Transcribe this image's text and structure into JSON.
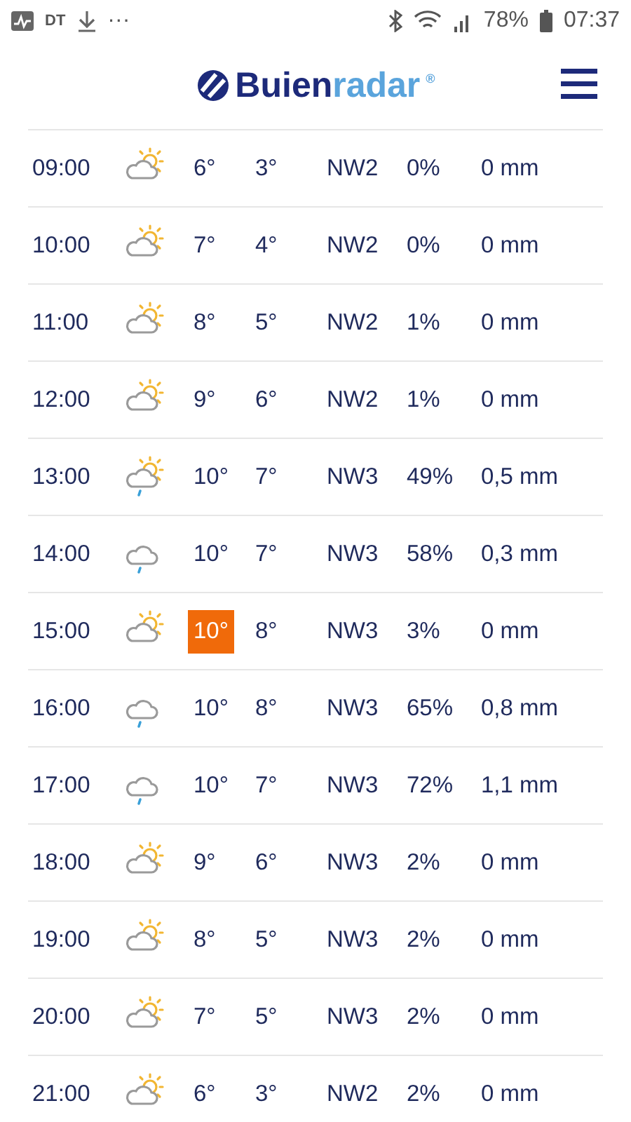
{
  "status_bar": {
    "left_texts": [
      "DT",
      "···"
    ],
    "battery": "78%",
    "time": "07:37"
  },
  "header": {
    "logo": {
      "word_1": "Buien",
      "word_2": "radar",
      "mark": "®"
    }
  },
  "forecast_rows": [
    {
      "time": "09:00",
      "kind": "sun-cloud",
      "temperature": "6°",
      "feels_like": "3°",
      "wind": "NW2",
      "chance": "0%",
      "rain": "0 mm",
      "highlighted": false
    },
    {
      "time": "10:00",
      "kind": "sun-cloud",
      "temperature": "7°",
      "feels_like": "4°",
      "wind": "NW2",
      "chance": "0%",
      "rain": "0 mm",
      "highlighted": false
    },
    {
      "time": "11:00",
      "kind": "sun-cloud",
      "temperature": "8°",
      "feels_like": "5°",
      "wind": "NW2",
      "chance": "1%",
      "rain": "0 mm",
      "highlighted": false
    },
    {
      "time": "12:00",
      "kind": "sun-cloud",
      "temperature": "9°",
      "feels_like": "6°",
      "wind": "NW2",
      "chance": "1%",
      "rain": "0 mm",
      "highlighted": false
    },
    {
      "time": "13:00",
      "kind": "sun-cloud-rain",
      "temperature": "10°",
      "feels_like": "7°",
      "wind": "NW3",
      "chance": "49%",
      "rain": "0,5 mm",
      "highlighted": false
    },
    {
      "time": "14:00",
      "kind": "cloud-rain",
      "temperature": "10°",
      "feels_like": "7°",
      "wind": "NW3",
      "chance": "58%",
      "rain": "0,3 mm",
      "highlighted": false
    },
    {
      "time": "15:00",
      "kind": "sun-cloud",
      "temperature": "10°",
      "feels_like": "8°",
      "wind": "NW3",
      "chance": "3%",
      "rain": "0 mm",
      "highlighted": true
    },
    {
      "time": "16:00",
      "kind": "cloud-rain",
      "temperature": "10°",
      "feels_like": "8°",
      "wind": "NW3",
      "chance": "65%",
      "rain": "0,8 mm",
      "highlighted": false
    },
    {
      "time": "17:00",
      "kind": "cloud-rain",
      "temperature": "10°",
      "feels_like": "7°",
      "wind": "NW3",
      "chance": "72%",
      "rain": "1,1 mm",
      "highlighted": false
    },
    {
      "time": "18:00",
      "kind": "sun-cloud",
      "temperature": "9°",
      "feels_like": "6°",
      "wind": "NW3",
      "chance": "2%",
      "rain": "0 mm",
      "highlighted": false
    },
    {
      "time": "19:00",
      "kind": "sun-cloud",
      "temperature": "8°",
      "feels_like": "5°",
      "wind": "NW3",
      "chance": "2%",
      "rain": "0 mm",
      "highlighted": false
    },
    {
      "time": "20:00",
      "kind": "sun-cloud",
      "temperature": "7°",
      "feels_like": "5°",
      "wind": "NW3",
      "chance": "2%",
      "rain": "0 mm",
      "highlighted": false
    },
    {
      "time": "21:00",
      "kind": "sun-cloud",
      "temperature": "6°",
      "feels_like": "3°",
      "wind": "NW2",
      "chance": "2%",
      "rain": "0 mm",
      "highlighted": false
    }
  ]
}
